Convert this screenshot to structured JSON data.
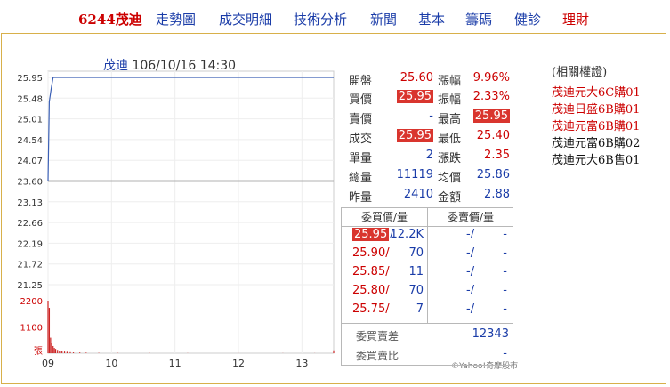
{
  "nav": {
    "stock": "6244茂迪",
    "items": [
      "走勢圖",
      "成交明細",
      "技術分析",
      "新聞",
      "基本",
      "籌碼",
      "健診",
      "理財"
    ]
  },
  "chart": {
    "name": "茂迪",
    "datetime": "106/10/16 14:30"
  },
  "quote": {
    "rows": [
      {
        "l1": "開盤",
        "v1": "25.60",
        "l2": "漲幅",
        "v2": "9.96%"
      },
      {
        "l1": "買價",
        "v1": "25.95",
        "l2": "振幅",
        "v2": "2.33%"
      },
      {
        "l1": "賣價",
        "v1": "-",
        "l2": "最高",
        "v2": "25.95"
      },
      {
        "l1": "成交",
        "v1": "25.95",
        "l2": "最低",
        "v2": "25.40"
      },
      {
        "l1": "單量",
        "v1": "2",
        "l2": "漲跌",
        "v2": "2.35"
      },
      {
        "l1": "總量",
        "v1": "11119",
        "l2": "均價",
        "v2": "25.86"
      },
      {
        "l1": "昨量",
        "v1": "2410",
        "l2": "金額",
        "v2": "2.88"
      }
    ]
  },
  "book": {
    "bid_header": "委買價/量",
    "ask_header": "委賣價/量",
    "rows": [
      {
        "bid": "25.95",
        "bid_vol": "12.2K",
        "ask": "-/",
        "ask_vol": "-"
      },
      {
        "bid": "25.90/",
        "bid_vol": "70",
        "ask": "-/",
        "ask_vol": "-"
      },
      {
        "bid": "25.85/",
        "bid_vol": "11",
        "ask": "-/",
        "ask_vol": "-"
      },
      {
        "bid": "25.80/",
        "bid_vol": "70",
        "ask": "-/",
        "ask_vol": "-"
      },
      {
        "bid": "25.75/",
        "bid_vol": "7",
        "ask": "-/",
        "ask_vol": "-"
      }
    ],
    "diff_label": "委買賣差",
    "diff_value": "12343",
    "ratio_label": "委買賣比",
    "ratio_value": "-"
  },
  "warrants": {
    "title": "(相關權證)",
    "items": [
      {
        "label": "茂迪元大6C購01",
        "color": "red"
      },
      {
        "label": "茂迪日盛6B購01",
        "color": "red"
      },
      {
        "label": "茂迪元富6B購01",
        "color": "red"
      },
      {
        "label": "茂迪元富6B購02",
        "color": "black"
      },
      {
        "label": "茂迪元大6B售01",
        "color": "black"
      }
    ]
  },
  "chart_data": {
    "type": "line",
    "title": "茂迪 106/10/16 14:30",
    "price_axis": {
      "ticks": [
        "25.95",
        "25.48",
        "25.01",
        "24.54",
        "24.07",
        "23.60",
        "23.13",
        "22.66",
        "22.19",
        "21.72",
        "21.25"
      ],
      "ylim": [
        21.25,
        25.95
      ]
    },
    "volume_axis": {
      "ticks": [
        "2200",
        "1100",
        "張"
      ]
    },
    "x_ticks": [
      "09",
      "10",
      "11",
      "12",
      "13"
    ],
    "reference_price": 23.6,
    "series": [
      {
        "values": [
          [
            9.0,
            23.6
          ],
          [
            9.02,
            25.4
          ],
          [
            9.05,
            25.7
          ],
          [
            9.08,
            25.95
          ],
          [
            13.5,
            25.95
          ]
        ]
      }
    ],
    "volume": [
      [
        9.0,
        2200
      ],
      [
        9.02,
        1900
      ],
      [
        9.04,
        650
      ],
      [
        9.06,
        420
      ],
      [
        9.08,
        300
      ],
      [
        9.1,
        220
      ],
      [
        9.12,
        180
      ],
      [
        9.15,
        140
      ],
      [
        9.18,
        110
      ],
      [
        9.22,
        90
      ],
      [
        9.26,
        70
      ],
      [
        9.3,
        60
      ],
      [
        9.35,
        45
      ],
      [
        9.4,
        35
      ],
      [
        9.5,
        30
      ],
      [
        9.6,
        25
      ],
      [
        9.8,
        15
      ],
      [
        10.1,
        10
      ],
      [
        10.6,
        8
      ],
      [
        11.2,
        6
      ],
      [
        12.0,
        5
      ],
      [
        12.7,
        5
      ],
      [
        13.2,
        4
      ],
      [
        13.5,
        120
      ]
    ],
    "copyright": "©Yahoo!奇摩股市"
  }
}
